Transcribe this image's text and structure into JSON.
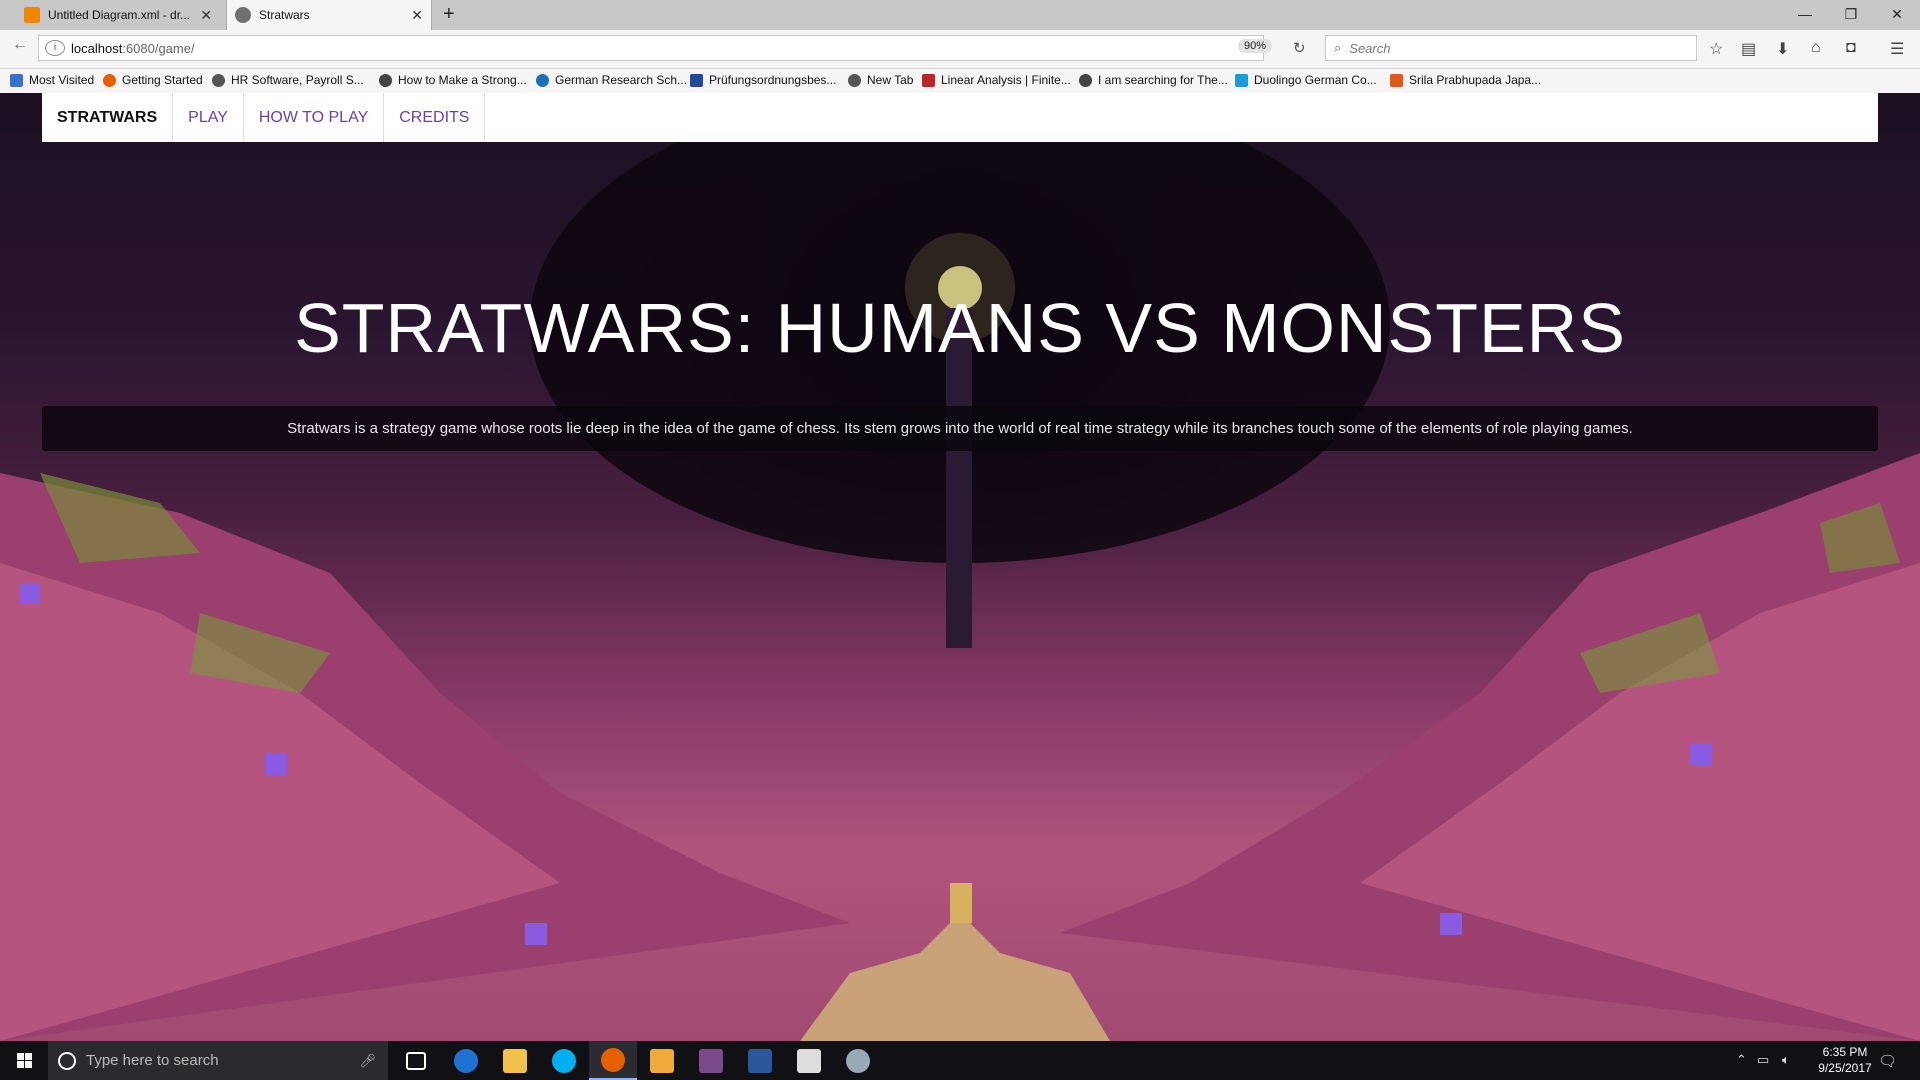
{
  "browser": {
    "tabs": [
      {
        "title": "Untitled Diagram.xml - dr...",
        "active": false
      },
      {
        "title": "Stratwars",
        "active": true
      }
    ],
    "new_tab": "+",
    "window_controls": [
      "—",
      "❐",
      "✕"
    ],
    "url_host": "localhost",
    "url_path": ":6080/game/",
    "zoom": "90%",
    "search_placeholder": "Search",
    "bookmarks": [
      {
        "label": "Most Visited",
        "color": "#3b6fd1"
      },
      {
        "label": "Getting Started",
        "color": "#e66000"
      },
      {
        "label": "HR Software, Payroll S...",
        "color": "#555555"
      },
      {
        "label": "How to Make a Strong...",
        "color": "#444444"
      },
      {
        "label": "German Research Sch...",
        "color": "#1a6fb8"
      },
      {
        "label": "Prüfungsordnungsbes...",
        "color": "#234a9a"
      },
      {
        "label": "New Tab",
        "color": "#555555"
      },
      {
        "label": "Linear Analysis | Finite...",
        "color": "#c0242b"
      },
      {
        "label": "I am searching for The...",
        "color": "#444444"
      },
      {
        "label": "Duolingo German Co...",
        "color": "#1c9bd8"
      },
      {
        "label": "Srila Prabhupada Japa...",
        "color": "#e05a16"
      }
    ]
  },
  "site": {
    "nav": {
      "brand": "STRATWARS",
      "items": [
        "PLAY",
        "HOW TO PLAY",
        "CREDITS"
      ]
    },
    "headline": "STRATWARS: HUMANS VS MONSTERS",
    "tagline": "Stratwars is a strategy game whose roots lie deep in the idea of the game of chess. Its stem grows into the world of real time strategy while its branches touch some of the elements of role playing games.",
    "colors": {
      "nav_link": "#6a3fb0",
      "accent_pink": "#b0547c"
    }
  },
  "taskbar": {
    "search_placeholder": "Type here to search",
    "time": "6:35 PM",
    "date": "9/25/2017",
    "apps": [
      {
        "name": "task-view",
        "color": "#ffffff"
      },
      {
        "name": "edge",
        "color": "#1e73d2"
      },
      {
        "name": "file-explorer",
        "color": "#f2c14b"
      },
      {
        "name": "skype",
        "color": "#00aff0"
      },
      {
        "name": "firefox",
        "color": "#e66000"
      },
      {
        "name": "outlook",
        "color": "#f2a93b"
      },
      {
        "name": "game",
        "color": "#7a4a8a"
      },
      {
        "name": "word",
        "color": "#2b579a"
      },
      {
        "name": "photos",
        "color": "#dddddd"
      },
      {
        "name": "other-app",
        "color": "#9aa9b8"
      }
    ]
  }
}
